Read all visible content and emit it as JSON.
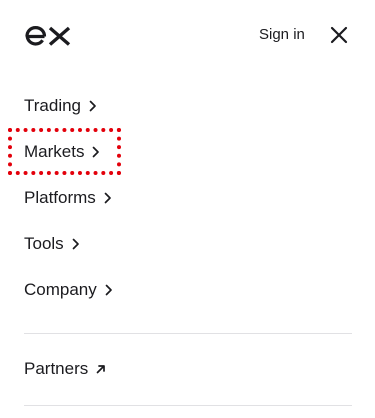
{
  "header": {
    "logo": "ex",
    "signin_label": "Sign in",
    "close_icon": "close-icon"
  },
  "menu": {
    "items": [
      {
        "label": "Trading",
        "icon": "chevron-right-icon"
      },
      {
        "label": "Markets",
        "icon": "chevron-right-icon",
        "highlighted": true
      },
      {
        "label": "Platforms",
        "icon": "chevron-right-icon"
      },
      {
        "label": "Tools",
        "icon": "chevron-right-icon"
      },
      {
        "label": "Company",
        "icon": "chevron-right-icon"
      }
    ],
    "secondary": [
      {
        "label": "Partners",
        "icon": "external-arrow-icon"
      }
    ]
  },
  "colors": {
    "text": "#1b1b1f",
    "highlight": "#e3000b",
    "divider": "#e1e1e4"
  }
}
